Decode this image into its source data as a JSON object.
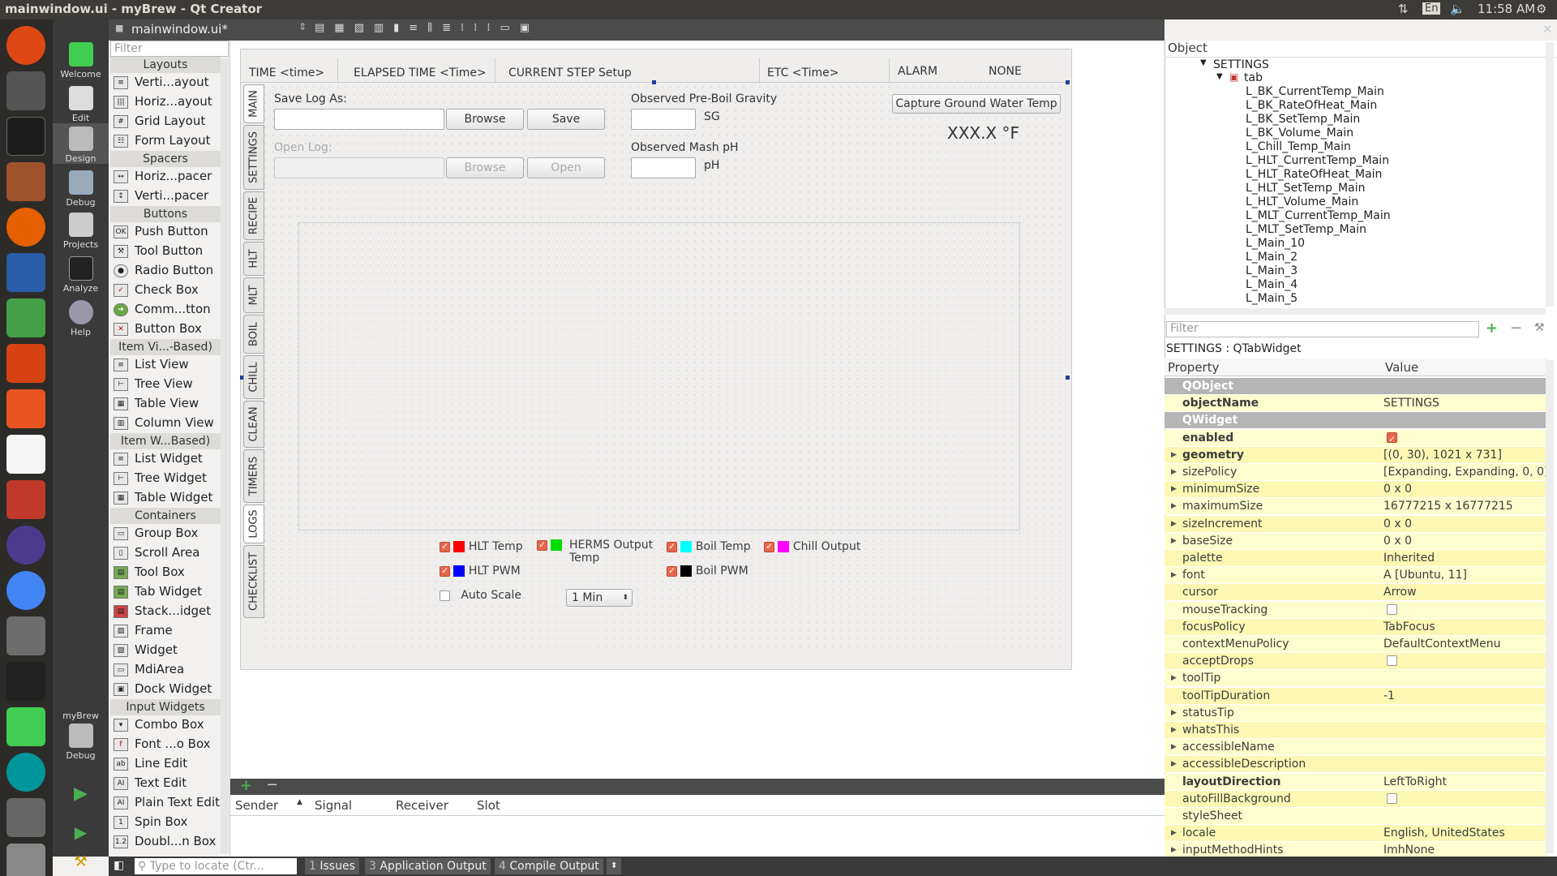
{
  "window_title": "mainwindow.ui - myBrew - Qt Creator",
  "tray": {
    "keyboard": "En",
    "time": "11:58 AM"
  },
  "modes": [
    "Welcome",
    "Edit",
    "Design",
    "Debug",
    "Projects",
    "Analyze",
    "Help"
  ],
  "kit": {
    "project": "myBrew",
    "mode": "Debug"
  },
  "editor": {
    "file_tab": "mainwindow.ui*"
  },
  "widget_box": {
    "filter_placeholder": "Filter",
    "categories": {
      "layouts": "Layouts",
      "spacers": "Spacers",
      "buttons": "Buttons",
      "item_views": "Item Vi...-Based)",
      "item_widgets": "Item W...Based)",
      "containers": "Containers",
      "input_widgets": "Input Widgets"
    },
    "items": {
      "vlayout": "Verti...ayout",
      "hlayout": "Horiz...ayout",
      "grid": "Grid Layout",
      "form": "Form Layout",
      "hspacer": "Horiz...pacer",
      "vspacer": "Verti...pacer",
      "push": "Push Button",
      "tool": "Tool Button",
      "radio": "Radio Button",
      "check": "Check Box",
      "command": "Comm...tton",
      "buttonbox": "Button Box",
      "listview": "List View",
      "treeview": "Tree View",
      "tableview": "Table View",
      "columnview": "Column View",
      "listwidget": "List Widget",
      "treewidget": "Tree Widget",
      "tablewidget": "Table Widget",
      "groupbox": "Group Box",
      "scrollarea": "Scroll Area",
      "toolbox": "Tool Box",
      "tabwidget": "Tab Widget",
      "stacked": "Stack...idget",
      "frame": "Frame",
      "widget": "Widget",
      "mdiarea": "MdiArea",
      "dock": "Dock Widget",
      "combo": "Combo Box",
      "fontcombo": "Font ...o Box",
      "lineedit": "Line Edit",
      "textedit": "Text Edit",
      "plaintext": "Plain Text Edit",
      "spin": "Spin Box",
      "doublespin": "Doubl...n Box"
    }
  },
  "form": {
    "header": {
      "time": "TIME  <time>",
      "elapsed": "ELAPSED TIME  <Time>",
      "step": "CURRENT STEP  Setup",
      "etc": "ETC <Time>",
      "alarm": "ALARM",
      "alarm_value": "NONE"
    },
    "tabs": [
      "MAIN",
      "SETTINGS",
      "RECIPE",
      "HLT",
      "MLT",
      "BOIL",
      "CHILL",
      "CLEAN",
      "TIMERS",
      "LOGS",
      "CHECKLIST"
    ],
    "save_log_label": "Save Log As:",
    "open_log_label": "Open Log:",
    "browse": "Browse",
    "save": "Save",
    "open": "Open",
    "gravity_label": "Observed Pre-Boil Gravity",
    "gravity_unit": "SG",
    "ph_label": "Observed Mash pH",
    "ph_unit": "pH",
    "capture_button": "Capture Ground Water Temp",
    "temp_readout": "XXX.X °F",
    "legend": {
      "hlt_temp": "HLT Temp",
      "herms_output": "HERMS Output",
      "herms_output_2": "Temp",
      "boil_temp": "Boil Temp",
      "chill_output": "Chill Output",
      "hlt_pwm": "HLT PWM",
      "boil_pwm": "Boil PWM"
    },
    "auto_scale": "Auto Scale",
    "interval": "1 Min"
  },
  "colors": {
    "hlt_temp": "#ff0000",
    "herms": "#00dd00",
    "boil_temp": "#00ffff",
    "chill": "#ff00ff",
    "hlt_pwm": "#0000ff",
    "boil_pwm": "#000000"
  },
  "signal_slot": {
    "columns": [
      "Sender",
      "Signal",
      "Receiver",
      "Slot"
    ]
  },
  "object_inspector": {
    "header": "Object",
    "root": "SETTINGS",
    "child": "tab",
    "items": [
      "L_BK_CurrentTemp_Main",
      "L_BK_RateOfHeat_Main",
      "L_BK_SetTemp_Main",
      "L_BK_Volume_Main",
      "L_Chill_Temp_Main",
      "L_HLT_CurrentTemp_Main",
      "L_HLT_RateOfHeat_Main",
      "L_HLT_SetTemp_Main",
      "L_HLT_Volume_Main",
      "L_MLT_CurrentTemp_Main",
      "L_MLT_SetTemp_Main",
      "L_Main_10",
      "L_Main_2",
      "L_Main_3",
      "L_Main_4",
      "L_Main_5"
    ]
  },
  "property_editor": {
    "filter_placeholder": "Filter",
    "title": "SETTINGS : QTabWidget",
    "col_property": "Property",
    "col_value": "Value",
    "rows": [
      {
        "name": "QObject",
        "value": ""
      },
      {
        "name": "objectName",
        "value": "SETTINGS"
      },
      {
        "name": "QWidget",
        "value": ""
      },
      {
        "name": "enabled",
        "value": ""
      },
      {
        "name": "geometry",
        "value": "[(0, 30), 1021 x 731]"
      },
      {
        "name": "sizePolicy",
        "value": "[Expanding, Expanding, 0, 0]"
      },
      {
        "name": "minimumSize",
        "value": "0 x 0"
      },
      {
        "name": "maximumSize",
        "value": "16777215 x 16777215"
      },
      {
        "name": "sizeIncrement",
        "value": "0 x 0"
      },
      {
        "name": "baseSize",
        "value": "0 x 0"
      },
      {
        "name": "palette",
        "value": "Inherited"
      },
      {
        "name": "font",
        "value": "A  [Ubuntu, 11]"
      },
      {
        "name": "cursor",
        "value": "Arrow"
      },
      {
        "name": "mouseTracking",
        "value": ""
      },
      {
        "name": "focusPolicy",
        "value": "TabFocus"
      },
      {
        "name": "contextMenuPolicy",
        "value": "DefaultContextMenu"
      },
      {
        "name": "acceptDrops",
        "value": ""
      },
      {
        "name": "toolTip",
        "value": ""
      },
      {
        "name": "toolTipDuration",
        "value": "-1"
      },
      {
        "name": "statusTip",
        "value": ""
      },
      {
        "name": "whatsThis",
        "value": ""
      },
      {
        "name": "accessibleName",
        "value": ""
      },
      {
        "name": "accessibleDescription",
        "value": ""
      },
      {
        "name": "layoutDirection",
        "value": "LeftToRight"
      },
      {
        "name": "autoFillBackground",
        "value": ""
      },
      {
        "name": "styleSheet",
        "value": ""
      },
      {
        "name": "locale",
        "value": "English, UnitedStates"
      },
      {
        "name": "inputMethodHints",
        "value": "ImhNone"
      }
    ]
  },
  "status_bar": {
    "locator_placeholder": "Type to locate (Ctr...",
    "tabs": [
      {
        "num": "1",
        "label": "Issues"
      },
      {
        "num": "3",
        "label": "Application Output"
      },
      {
        "num": "4",
        "label": "Compile Output"
      }
    ]
  }
}
